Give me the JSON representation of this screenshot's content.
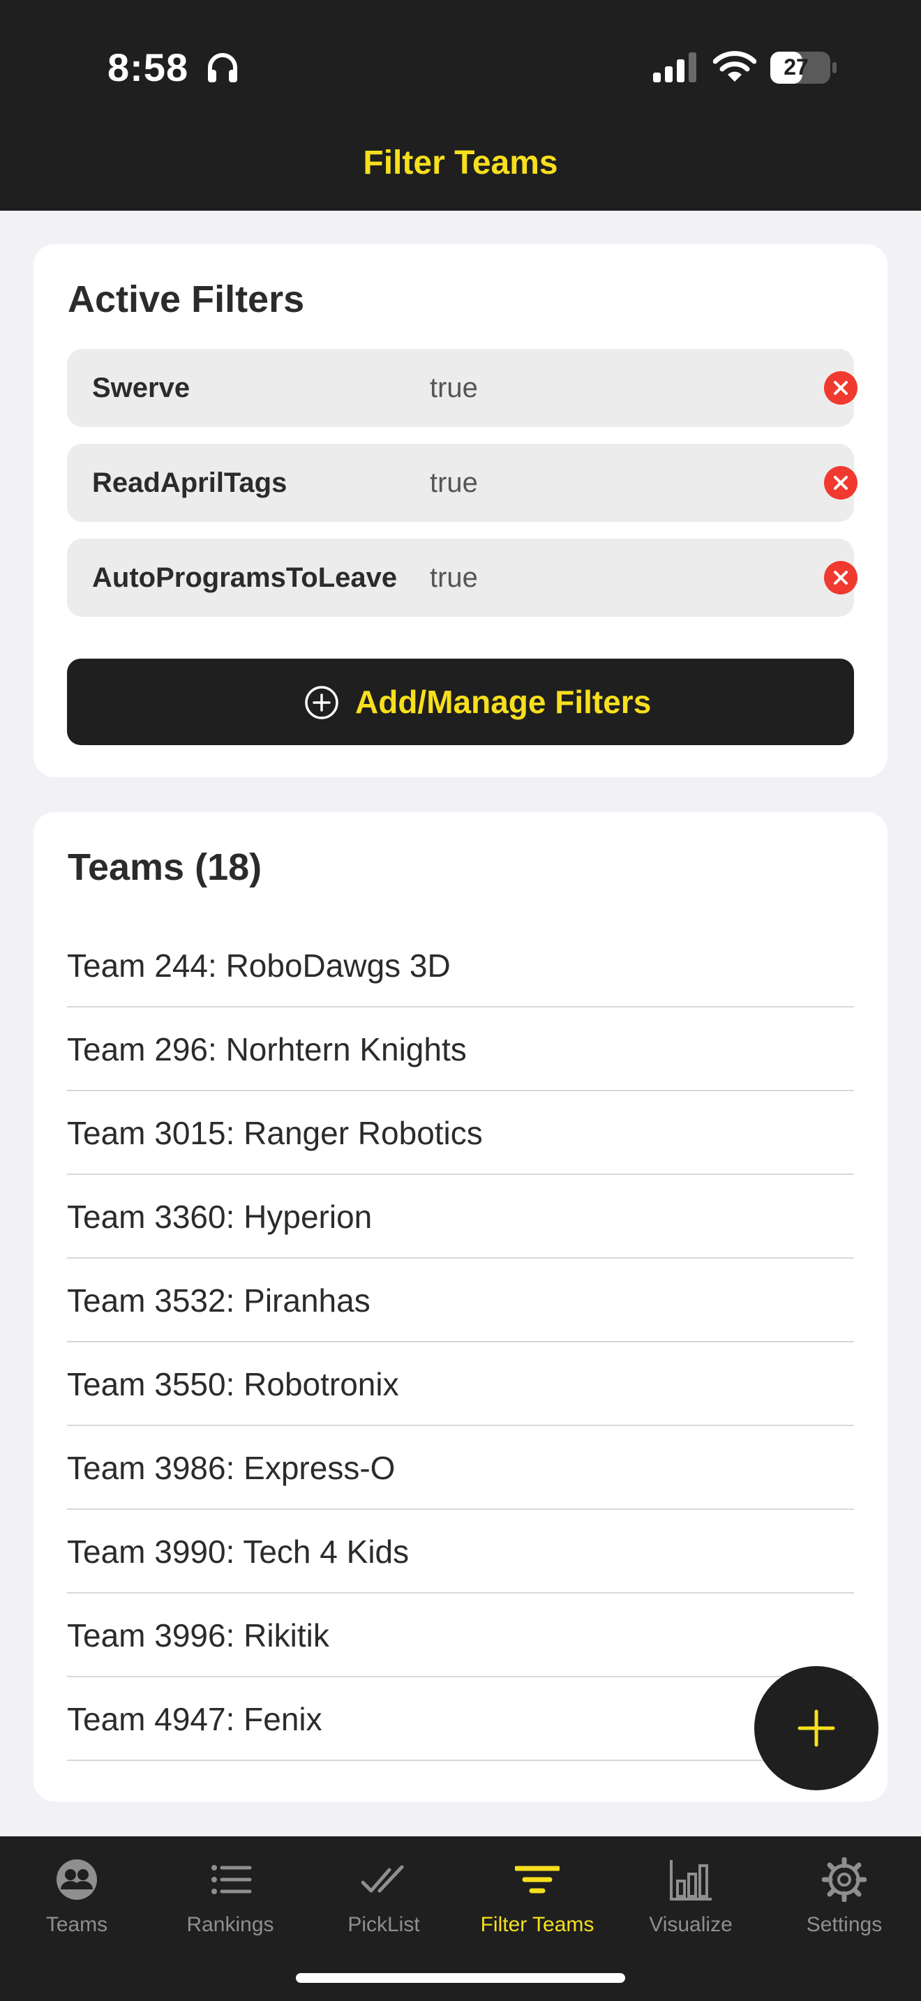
{
  "status_bar": {
    "time": "8:58",
    "battery_level": "27",
    "icons": [
      "headphones-icon",
      "signal-icon",
      "wifi-icon",
      "battery-icon"
    ]
  },
  "header": {
    "title": "Filter Teams"
  },
  "active_filters": {
    "title": "Active Filters",
    "filters": [
      {
        "name": "Swerve",
        "value": "true"
      },
      {
        "name": "ReadAprilTags",
        "value": "true"
      },
      {
        "name": "AutoProgramsToLeave",
        "value": "true"
      }
    ],
    "add_button_label": "Add/Manage Filters"
  },
  "teams": {
    "title": "Teams (18)",
    "items": [
      "Team 244: RoboDawgs 3D",
      "Team 296: Norhtern Knights",
      "Team 3015: Ranger Robotics",
      "Team 3360: Hyperion",
      "Team 3532: Piranhas",
      "Team 3550: Robotronix",
      "Team 3986: Express-O",
      "Team 3990: Tech 4 Kids",
      "Team 3996: Rikitik",
      "Team 4947: Fenix"
    ]
  },
  "tab_bar": {
    "active_tab": "Filter Teams",
    "tabs": [
      {
        "label": "Teams",
        "icon": "teams-icon"
      },
      {
        "label": "Rankings",
        "icon": "list-icon"
      },
      {
        "label": "PickList",
        "icon": "checkmarks-icon"
      },
      {
        "label": "Filter Teams",
        "icon": "filter-icon"
      },
      {
        "label": "Visualize",
        "icon": "bar-chart-icon"
      },
      {
        "label": "Settings",
        "icon": "gear-icon"
      }
    ]
  },
  "colors": {
    "accent": "#f7df1e",
    "bar_background": "#1f1f1f",
    "page_background": "#f2f2f6",
    "remove_red": "#f0392f",
    "inactive_tab": "#8f8f8f"
  }
}
